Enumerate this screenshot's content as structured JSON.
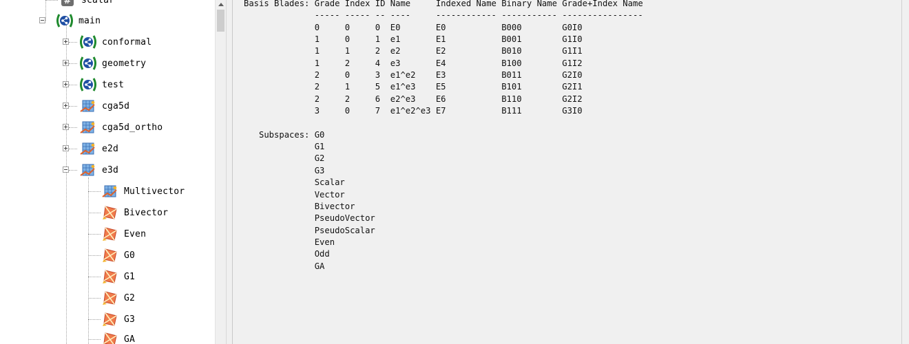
{
  "tree": {
    "scalar_label": "scalar",
    "main_label": "main",
    "conformal_label": "conformal",
    "geometry_label": "geometry",
    "test_label": "test",
    "cga5d_label": "cga5d",
    "cga5d_ortho_label": "cga5d_ortho",
    "e2d_label": "e2d",
    "e3d_label": "e3d",
    "multivector_label": "Multivector",
    "bivector_label": "Bivector",
    "even_label": "Even",
    "g0_label": "G0",
    "g1_label": "G1",
    "g2_label": "G2",
    "g3_label": "G3",
    "ga_label": "GA",
    "icons": {
      "scalar": "hash-icon",
      "namespace": "namespace-icon",
      "frame": "frame-icon",
      "multivector": "multivector-icon",
      "subspace": "subspace-icon"
    }
  },
  "details": {
    "text": "Basis Blades: Grade Index ID Name     Indexed Name Binary Name Grade+Index Name\n              ----- ----- -- ----     ------------ ----------- ----------------\n              0     0     0  E0       E0           B000        G0I0\n              1     0     1  e1       E1           B001        G1I0\n              1     1     2  e2       E2           B010        G1I1\n              1     2     4  e3       E4           B100        G1I2\n              2     0     3  e1^e2    E3           B011        G2I0\n              2     1     5  e1^e3    E5           B101        G2I1\n              2     2     6  e2^e3    E6           B110        G2I2\n              3     0     7  e1^e2^e3 E7           B111        G3I0\n\n   Subspaces: G0\n              G1\n              G2\n              G3\n              Scalar\n              Vector\n              Bivector\n              PseudoVector\n              PseudoScalar\n              Even\n              Odd\n              GA"
  },
  "colors": {
    "namespace_green": "#1f8a2e",
    "namespace_blue": "#1f4fa3",
    "panel_bg": "#f0f0f0"
  }
}
